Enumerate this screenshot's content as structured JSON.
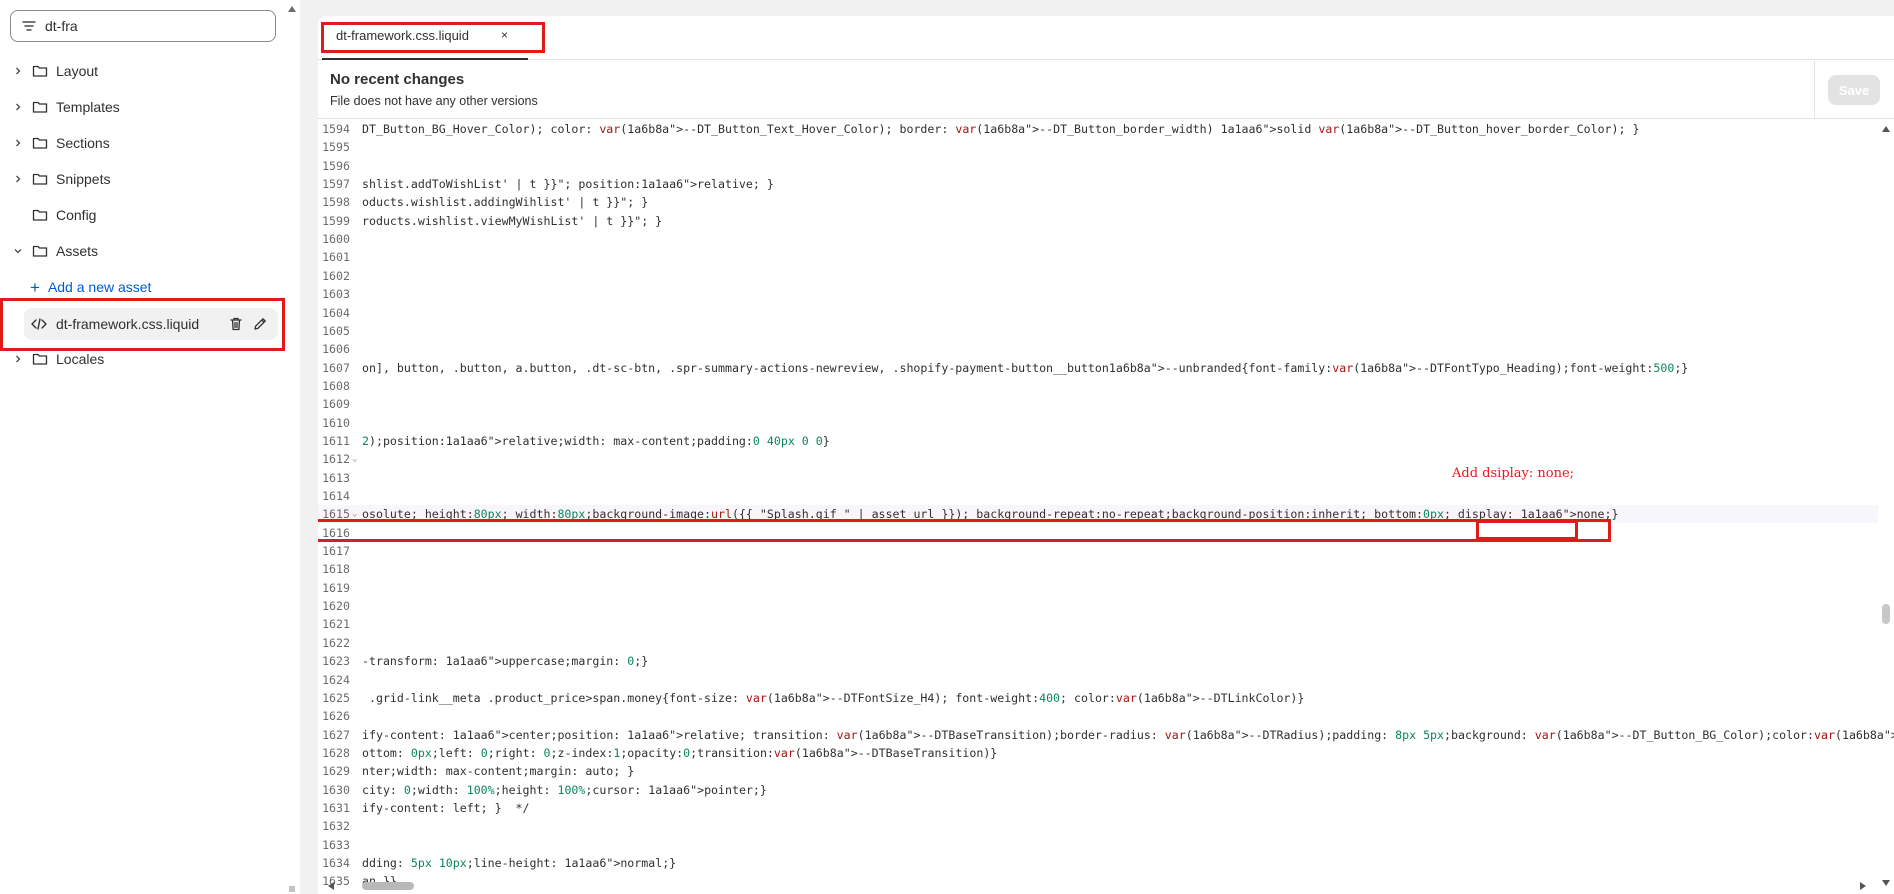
{
  "sidebar": {
    "search": {
      "value": "dt-fra"
    },
    "folders": [
      {
        "label": "Layout",
        "expanded": false
      },
      {
        "label": "Templates",
        "expanded": false
      },
      {
        "label": "Sections",
        "expanded": false
      },
      {
        "label": "Snippets",
        "expanded": false
      },
      {
        "label": "Config",
        "expanded": null
      },
      {
        "label": "Assets",
        "expanded": true
      },
      {
        "label": "Locales",
        "expanded": false
      }
    ],
    "add_asset_label": "Add a new asset",
    "file_item": {
      "label": "dt-framework.css.liquid",
      "icon": "code-icon"
    }
  },
  "editor": {
    "tab": {
      "label": "dt-framework.css.liquid",
      "close": "×"
    },
    "info": {
      "title": "No recent changes",
      "subtitle": "File does not have any other versions"
    },
    "save_label": "Save",
    "annotation": "Add dsiplay: none;",
    "lines": [
      {
        "n": "1594",
        "text": "DT_Button_BG_Hover_Color); color: var(--DT_Button_Text_Hover_Color); border: var(--DT_Button_border_width) solid var(--DT_Button_hover_border_Color); }"
      },
      {
        "n": "1595",
        "text": ""
      },
      {
        "n": "1596",
        "text": ""
      },
      {
        "n": "1597",
        "text": "shlist.addToWishList' | t }}\"; position:relative; }"
      },
      {
        "n": "1598",
        "text": "oducts.wishlist.addingWihlist' | t }}\"; }"
      },
      {
        "n": "1599",
        "text": "roducts.wishlist.viewMyWishList' | t }}\"; }"
      },
      {
        "n": "1600",
        "text": ""
      },
      {
        "n": "1601",
        "text": ""
      },
      {
        "n": "1602",
        "text": ""
      },
      {
        "n": "1603",
        "text": ""
      },
      {
        "n": "1604",
        "text": ""
      },
      {
        "n": "1605",
        "text": ""
      },
      {
        "n": "1606",
        "text": ""
      },
      {
        "n": "1607",
        "text": "on], button, .button, a.button, .dt-sc-btn, .spr-summary-actions-newreview, .shopify-payment-button__button--unbranded{font-family:var(--DTFontTypo_Heading);font-weight:500;}"
      },
      {
        "n": "1608",
        "text": ""
      },
      {
        "n": "1609",
        "text": ""
      },
      {
        "n": "1610",
        "text": ""
      },
      {
        "n": "1611",
        "text": "2);position:relative;width: max-content;padding:0 40px 0 0}"
      },
      {
        "n": "1612",
        "text": "",
        "fold": "⌄"
      },
      {
        "n": "1613",
        "text": ""
      },
      {
        "n": "1614",
        "text": ""
      },
      {
        "n": "1615",
        "text": "osolute; height:80px; width:80px;background-image:url({{ \"Splash.gif \" | asset_url }}); background-repeat:no-repeat;background-position:inherit; bottom:0px; display: none;}",
        "fold": "⌄",
        "active": true
      },
      {
        "n": "1616",
        "text": ""
      },
      {
        "n": "1617",
        "text": ""
      },
      {
        "n": "1618",
        "text": ""
      },
      {
        "n": "1619",
        "text": ""
      },
      {
        "n": "1620",
        "text": ""
      },
      {
        "n": "1621",
        "text": ""
      },
      {
        "n": "1622",
        "text": ""
      },
      {
        "n": "1623",
        "text": "-transform: uppercase;margin: 0;}"
      },
      {
        "n": "1624",
        "text": ""
      },
      {
        "n": "1625",
        "text": " .grid-link__meta .product_price>span.money{font-size: var(--DTFontSize_H4); font-weight:400; color:var(--DTLinkColor)}"
      },
      {
        "n": "1626",
        "text": ""
      },
      {
        "n": "1627",
        "text": "ify-content: center;position: relative; transition: var(--DTBaseTransition);border-radius: var(--DTRadius);padding: 8px 5px;background: var(--DT_Button_BG_Color);color:var(--DT_Button_Text_Color)}"
      },
      {
        "n": "1628",
        "text": "ottom: 0px;left: 0;right: 0;z-index:1;opacity:0;transition:var(--DTBaseTransition)}"
      },
      {
        "n": "1629",
        "text": "nter;width: max-content;margin: auto; }"
      },
      {
        "n": "1630",
        "text": "city: 0;width: 100%;height: 100%;cursor: pointer;}"
      },
      {
        "n": "1631",
        "text": "ify-content: left; }  */"
      },
      {
        "n": "1632",
        "text": ""
      },
      {
        "n": "1633",
        "text": ""
      },
      {
        "n": "1634",
        "text": "dding: 5px 10px;line-height: normal;}"
      },
      {
        "n": "1635",
        "text": "an }}"
      }
    ]
  },
  "colors": {
    "highlight": "#e01b1b",
    "link": "#005bd3",
    "text": "#303030"
  }
}
